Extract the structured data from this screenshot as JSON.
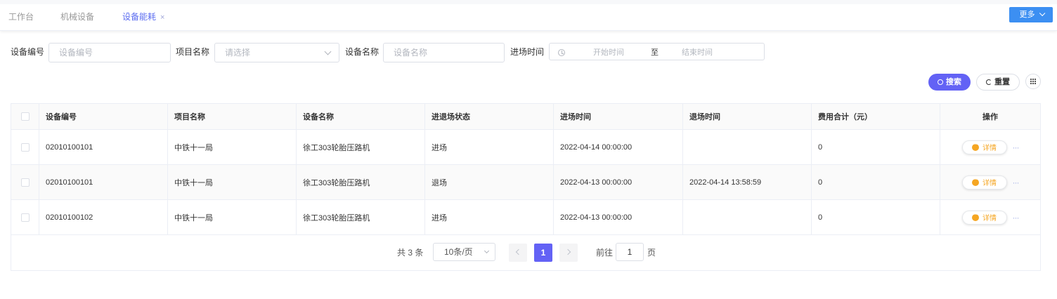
{
  "tabs": [
    {
      "label": "工作台",
      "active": false
    },
    {
      "label": "机械设备",
      "active": false
    },
    {
      "label": "设备能耗",
      "active": true,
      "close": "×"
    }
  ],
  "more_button": {
    "label": "更多"
  },
  "filters": {
    "device_code": {
      "label": "设备编号",
      "placeholder": "设备编号"
    },
    "project_name": {
      "label": "项目名称",
      "placeholder": "请选择"
    },
    "device_name": {
      "label": "设备名称",
      "placeholder": "设备名称"
    },
    "entry_time": {
      "label": "进场时间",
      "start_placeholder": "开始时间",
      "separator": "至",
      "end_placeholder": "结束时间"
    }
  },
  "actions": {
    "search": "搜索",
    "reset": "重置"
  },
  "table": {
    "columns": [
      "设备编号",
      "项目名称",
      "设备名称",
      "进退场状态",
      "进场时间",
      "退场时间",
      "费用合计（元）",
      "操作"
    ],
    "rows": [
      {
        "code": "02010100101",
        "project": "中铁十一局",
        "device": "徐工303轮胎压路机",
        "status": "进场",
        "entry": "2022-04-14 00:00:00",
        "exit": "",
        "cost": "0"
      },
      {
        "code": "02010100101",
        "project": "中铁十一局",
        "device": "徐工303轮胎压路机",
        "status": "退场",
        "entry": "2022-04-13 00:00:00",
        "exit": "2022-04-14 13:58:59",
        "cost": "0"
      },
      {
        "code": "02010100102",
        "project": "中铁十一局",
        "device": "徐工303轮胎压路机",
        "status": "进场",
        "entry": "2022-04-13 00:00:00",
        "exit": "",
        "cost": "0"
      }
    ],
    "detail_label": "详情",
    "more_label": "···"
  },
  "pagination": {
    "total": "共 3 条",
    "page_size": "10条/页",
    "current_page": "1",
    "goto_label": "前往",
    "goto_value": "1",
    "page_label": "页"
  },
  "colors": {
    "accent": "#6362f5",
    "tab_active": "#5b6cf0",
    "more_button": "#3c8ff2",
    "detail": "#f5a623"
  }
}
